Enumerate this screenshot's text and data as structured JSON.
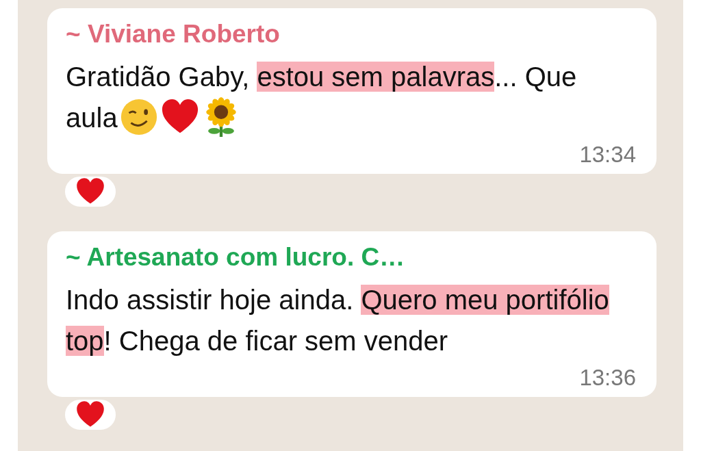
{
  "messages": [
    {
      "sender": "~ Viviane Roberto",
      "color": "#e0697a",
      "segments": [
        {
          "text": "Gratidão Gaby, ",
          "highlighted": false
        },
        {
          "text": "estou sem palavras",
          "highlighted": true
        },
        {
          "text": "... Que aula",
          "highlighted": false
        }
      ],
      "emojis": [
        {
          "kind": "wink"
        },
        {
          "kind": "heart"
        },
        {
          "kind": "sunflower"
        }
      ],
      "time": "13:34",
      "reaction": {
        "kind": "heart"
      }
    },
    {
      "sender": "~ Artesanato com lucro. C…",
      "color": "#1fa855",
      "segments": [
        {
          "text": "Indo assistir hoje ainda. ",
          "highlighted": false
        },
        {
          "text": "Quero meu portifólio top",
          "highlighted": true
        },
        {
          "text": "! Chega de ficar sem vender",
          "highlighted": false
        }
      ],
      "time": "13:36",
      "reaction": {
        "kind": "heart"
      }
    }
  ]
}
